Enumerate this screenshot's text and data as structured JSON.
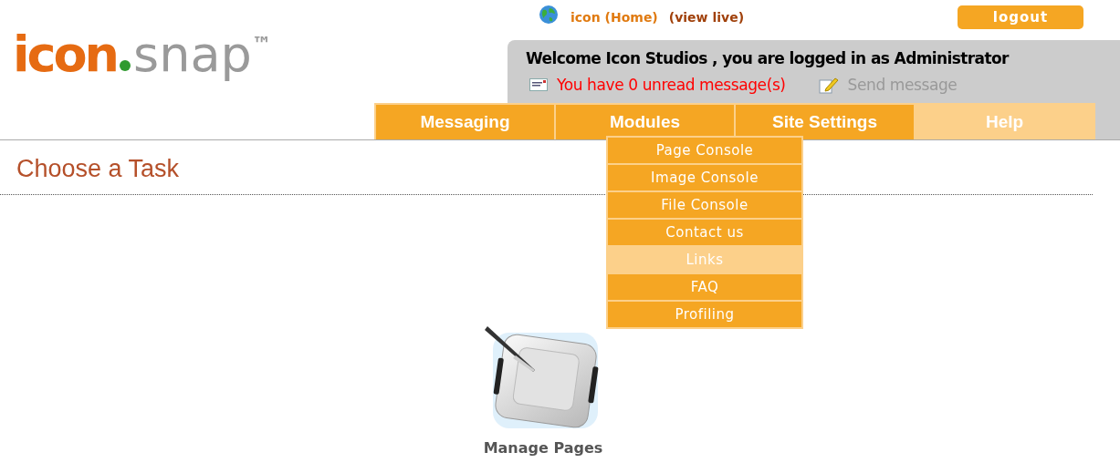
{
  "logo": {
    "brand": "icon",
    "product": "snap",
    "mark": "™"
  },
  "top_links": [
    {
      "label": "icon (Home)"
    },
    {
      "label": "(view live)"
    }
  ],
  "logout": "logout",
  "welcome": "Welcome Icon Studios , you are logged in as Administrator",
  "unread": "You have 0 unread message(s)",
  "send_message": "Send message",
  "nav": [
    {
      "label": "Messaging",
      "selected": false
    },
    {
      "label": "Modules",
      "selected": false,
      "menu": [
        {
          "label": "Page Console",
          "selected": false
        },
        {
          "label": "Image Console",
          "selected": false
        },
        {
          "label": "File Console",
          "selected": false
        },
        {
          "label": "Contact us",
          "selected": false
        },
        {
          "label": "Links",
          "selected": true
        },
        {
          "label": "FAQ",
          "selected": false
        },
        {
          "label": "Profiling",
          "selected": false
        }
      ]
    },
    {
      "label": "Site Settings",
      "selected": false
    },
    {
      "label": "Help",
      "selected": true
    }
  ],
  "heading": "Choose a Task",
  "tasks": [
    {
      "label": "Manage Pages"
    }
  ]
}
